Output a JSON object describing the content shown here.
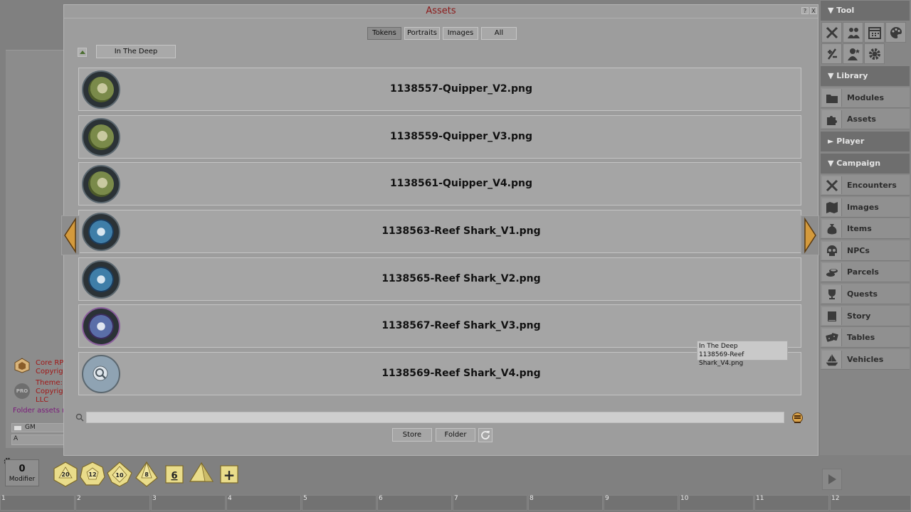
{
  "chat": {
    "line1": "Core RPG",
    "line2": "Copyright",
    "line3": "Theme: S",
    "line4": "Copyright",
    "line5": "LLC",
    "pro_badge": "PRO",
    "folder_message": "Folder assets re",
    "identity": "GM",
    "entry_value": "A"
  },
  "assets": {
    "title": "Assets",
    "help": "?",
    "close": "X",
    "tabs": [
      {
        "label": "Tokens",
        "active": true
      },
      {
        "label": "Portraits",
        "active": false
      },
      {
        "label": "Images",
        "active": false
      },
      {
        "label": "All",
        "active": false
      }
    ],
    "folder": "In The Deep",
    "items": [
      {
        "name": "1138557-Quipper_V2.png",
        "thumb": "quipper"
      },
      {
        "name": "1138559-Quipper_V3.png",
        "thumb": "quipper"
      },
      {
        "name": "1138561-Quipper_V4.png",
        "thumb": "quipper"
      },
      {
        "name": "1138563-Reef Shark_V1.png",
        "thumb": "shark"
      },
      {
        "name": "1138565-Reef Shark_V2.png",
        "thumb": "shark"
      },
      {
        "name": "1138567-Reef Shark_V3.png",
        "thumb": "shark-purple"
      },
      {
        "name": "1138569-Reef Shark_V4.png",
        "thumb": "loading"
      }
    ],
    "tooltip": {
      "line1": "In The Deep",
      "line2": "1138569-Reef Shark_V4.png"
    },
    "search_value": "",
    "store_label": "Store",
    "folder_label": "Folder"
  },
  "sidebar": {
    "tool_header": "Tool",
    "library_header": "Library",
    "library_items": [
      "Modules",
      "Assets"
    ],
    "player_header": "Player",
    "campaign_header": "Campaign",
    "campaign_items": [
      "Encounters",
      "Images",
      "Items",
      "NPCs",
      "Parcels",
      "Quests",
      "Story",
      "Tables",
      "Vehicles"
    ]
  },
  "dice": {
    "modifier_value": "0",
    "modifier_label": "Modifier",
    "dice": [
      "20",
      "12",
      "10",
      "8",
      "6",
      "4",
      "+"
    ]
  },
  "hotkeys": [
    "1",
    "2",
    "3",
    "4",
    "5",
    "6",
    "7",
    "8",
    "9",
    "10",
    "11",
    "12"
  ],
  "colors": {
    "accent_red": "#8b1a1a",
    "die_yellow": "#e9dc8a",
    "sidebar_header": "#6e6e6e"
  }
}
